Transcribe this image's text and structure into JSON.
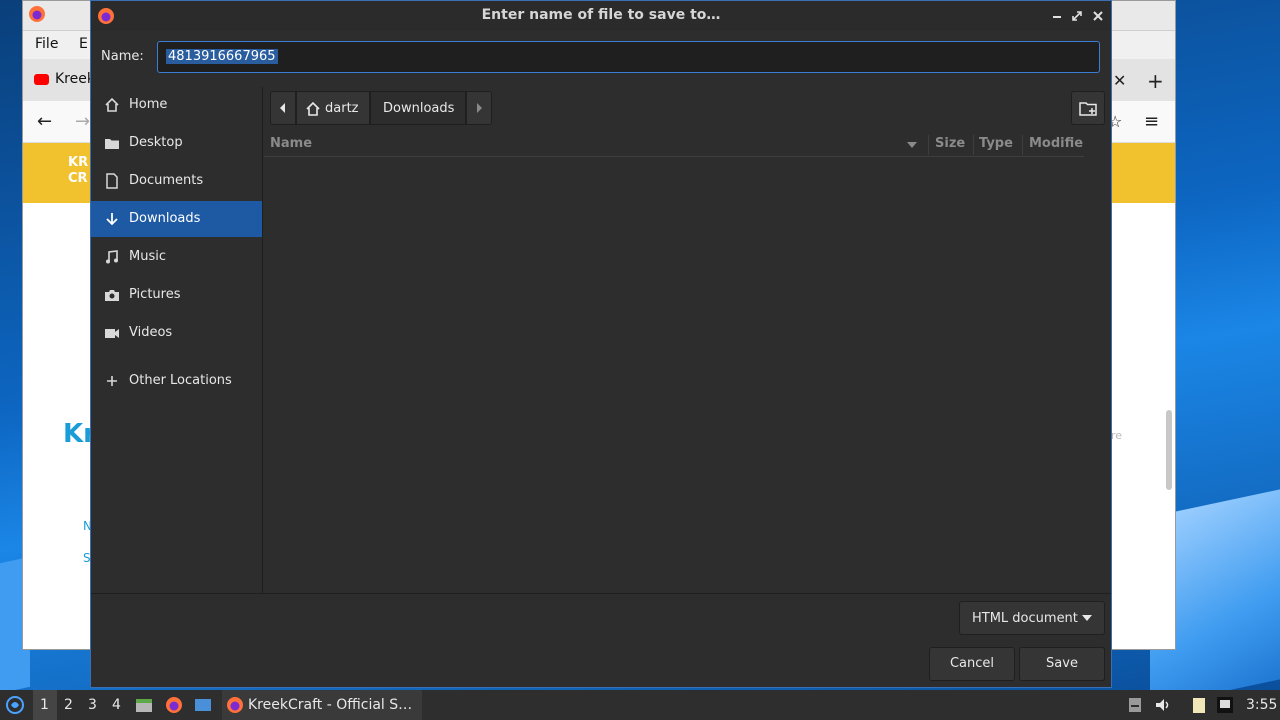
{
  "background_window": {
    "menu_file": "File",
    "menu_edit": "E",
    "tab_title": "Kreek",
    "banner_text_1": "KR",
    "banner_text_2": "CR",
    "page_big_text": "Kr",
    "page_small_1": "N",
    "page_small_2": "S",
    "right_faint": "re"
  },
  "dialog": {
    "title": "Enter name of file to save to…",
    "name_label": "Name:",
    "name_value": "4813916667965",
    "sidebar": [
      {
        "label": "Home",
        "icon": "home-icon"
      },
      {
        "label": "Desktop",
        "icon": "folder-icon"
      },
      {
        "label": "Documents",
        "icon": "document-icon"
      },
      {
        "label": "Downloads",
        "icon": "download-icon",
        "active": true
      },
      {
        "label": "Music",
        "icon": "music-icon"
      },
      {
        "label": "Pictures",
        "icon": "camera-icon"
      },
      {
        "label": "Videos",
        "icon": "video-icon"
      },
      {
        "label": "Other Locations",
        "icon": "plus-icon"
      }
    ],
    "path": {
      "home": "dartz",
      "current": "Downloads"
    },
    "columns": {
      "name": "Name",
      "size": "Size",
      "type": "Type",
      "modified": "Modifie"
    },
    "filter": "HTML document",
    "cancel": "Cancel",
    "save": "Save"
  },
  "taskbar": {
    "workspaces": [
      "1",
      "2",
      "3",
      "4"
    ],
    "active_workspace": "1",
    "task_title": "KreekCraft - Official S…",
    "clock": "3:55"
  },
  "colors": {
    "dialog_bg": "#2d2d2d",
    "accent": "#1d5aa3",
    "selection": "#2a5d9e",
    "taskbar_bg": "#2e2e2e"
  }
}
